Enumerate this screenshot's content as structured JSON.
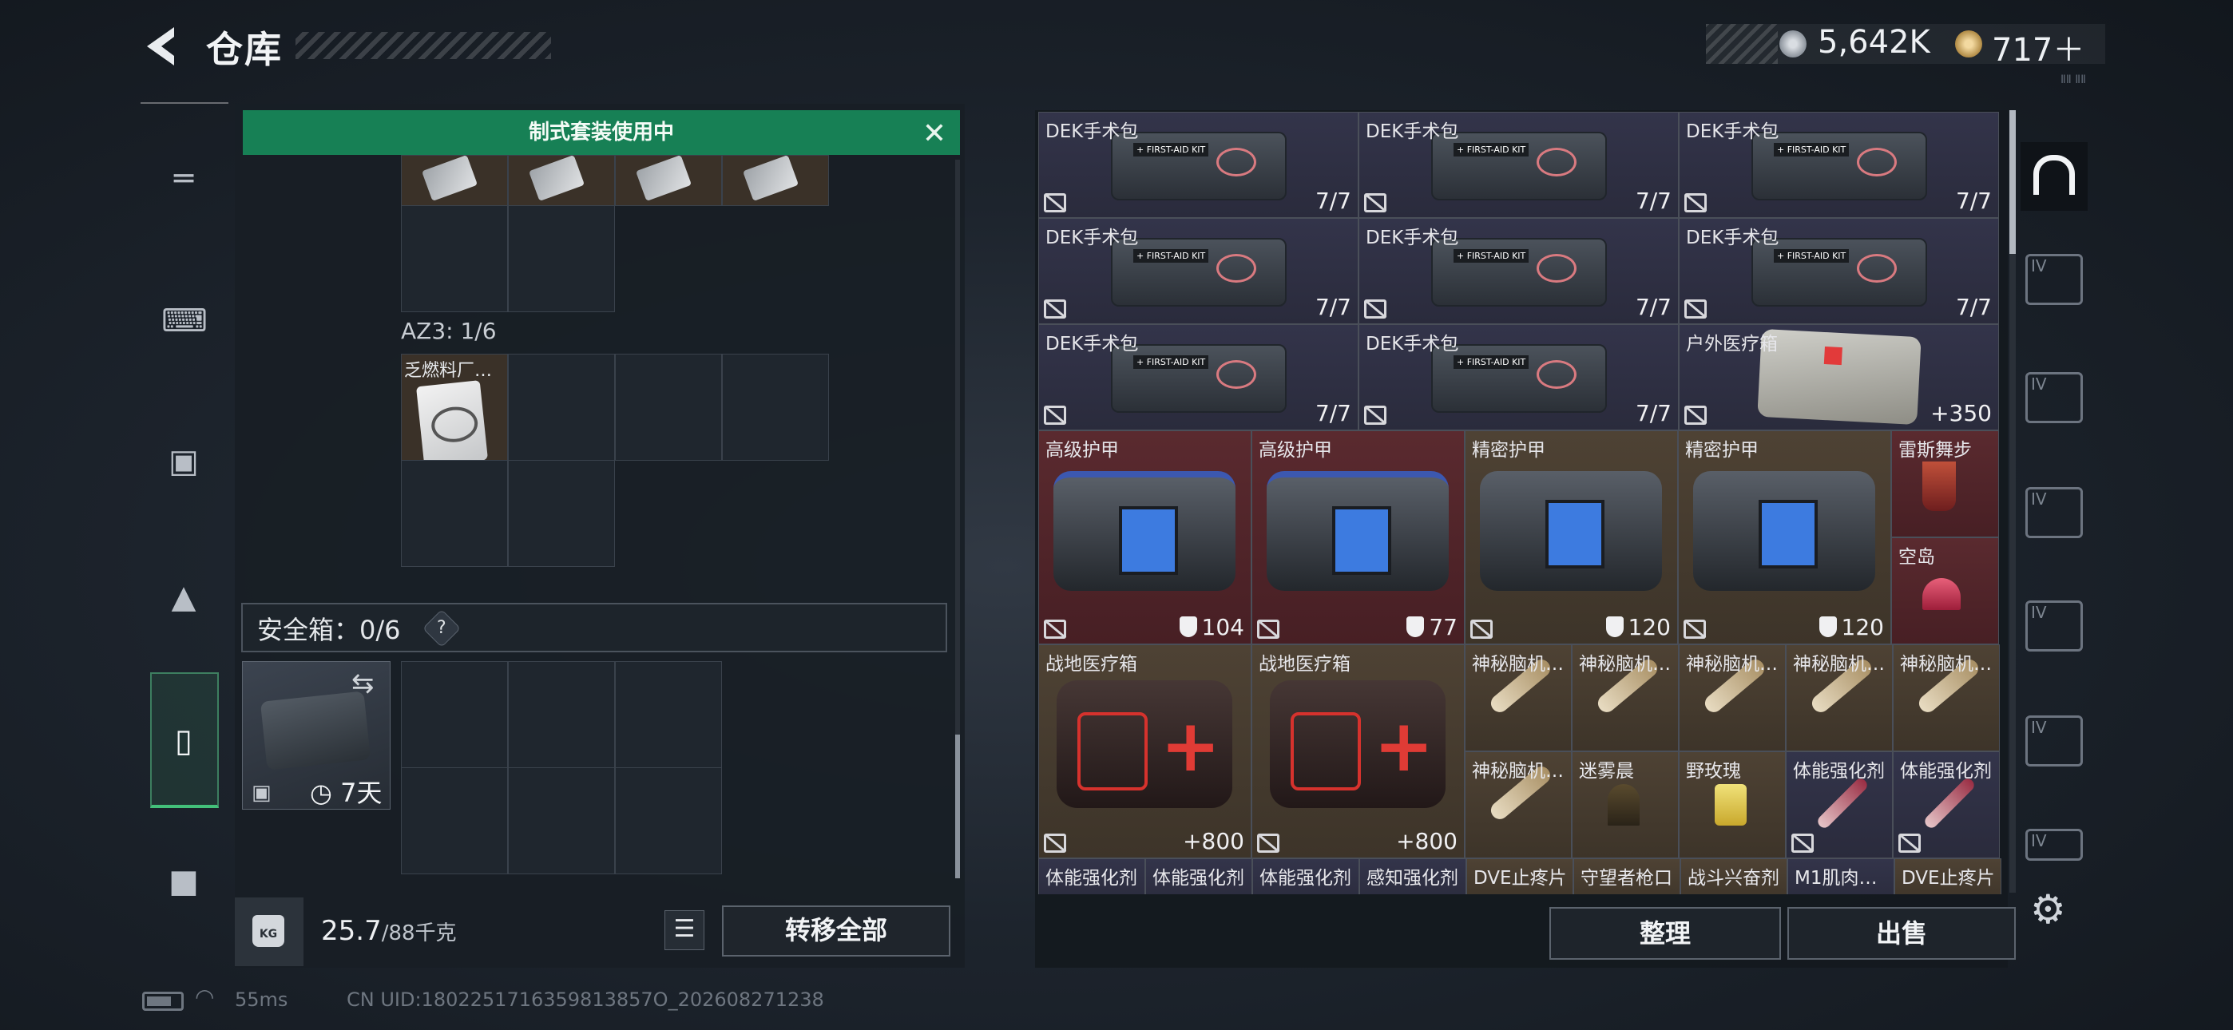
{
  "header": {
    "title": "仓库",
    "currency": [
      {
        "icon": "silver-coin-icon",
        "value": "5,642K"
      },
      {
        "icon": "gold-coin-icon",
        "value": "717＋"
      }
    ]
  },
  "left_nav": {
    "items": [
      "gun-icon",
      "vest-icon",
      "backpack-icon",
      "bag-icon",
      "case-icon",
      "toolbox-icon"
    ],
    "active_index": 4
  },
  "loadout": {
    "banner": "制式套装使用中",
    "container_label": "AZ3: 1/6",
    "container_item": "乏燃料厂…",
    "safebox_label": "安全箱：0/6",
    "help": "?",
    "safebox_duration": "7天",
    "weight_value": "25.7",
    "weight_max": "/88千克",
    "transfer_label": "转移全部"
  },
  "stash": {
    "rows": [
      [
        {
          "name": "DEK手术包",
          "count": "7/7",
          "bg": "purple"
        },
        {
          "name": "DEK手术包",
          "count": "7/7",
          "bg": "purple"
        },
        {
          "name": "DEK手术包",
          "count": "7/7",
          "bg": "purple"
        }
      ],
      [
        {
          "name": "DEK手术包",
          "count": "7/7",
          "bg": "purple"
        },
        {
          "name": "DEK手术包",
          "count": "7/7",
          "bg": "purple"
        },
        {
          "name": "DEK手术包",
          "count": "7/7",
          "bg": "purple"
        }
      ],
      [
        {
          "name": "DEK手术包",
          "count": "7/7",
          "bg": "purple"
        },
        {
          "name": "DEK手术包",
          "count": "7/7",
          "bg": "purple"
        },
        {
          "name": "户外医疗箱",
          "count": "+350",
          "bg": "purple"
        }
      ]
    ],
    "armor": [
      {
        "name": "高级护甲",
        "value": "104",
        "bg": "red"
      },
      {
        "name": "高级护甲",
        "value": "77",
        "bg": "red"
      },
      {
        "name": "精密护甲",
        "value": "120",
        "bg": "brown"
      },
      {
        "name": "精密护甲",
        "value": "120",
        "bg": "brown"
      }
    ],
    "drinks": [
      {
        "name": "雷斯舞步",
        "bg": "red"
      },
      {
        "name": "空岛",
        "bg": "red"
      }
    ],
    "medkits": [
      {
        "name": "战地医疗箱",
        "count": "+800"
      },
      {
        "name": "战地医疗箱",
        "count": "+800"
      }
    ],
    "small_row1": [
      "神秘脑机…",
      "神秘脑机…",
      "神秘脑机…",
      "神秘脑机…",
      "神秘脑机…"
    ],
    "small_row2": [
      "神秘脑机…",
      "迷雾晨",
      "野玫瑰",
      "体能强化剂",
      "体能强化剂"
    ],
    "bottom_row": [
      "体能强化剂",
      "体能强化剂",
      "体能强化剂",
      "感知强化剂",
      "DVE止疼片",
      "守望者枪口",
      "战斗兴奋剂",
      "M1肌肉…",
      "DVE止疼片"
    ],
    "sort_label": "整理",
    "sell_label": "出售"
  },
  "status": {
    "ping": "55ms",
    "uid": "CN UID:1802251716359813857O_202608271238",
    "corner_mark": "ⅡⅡ ⅡⅡ"
  }
}
